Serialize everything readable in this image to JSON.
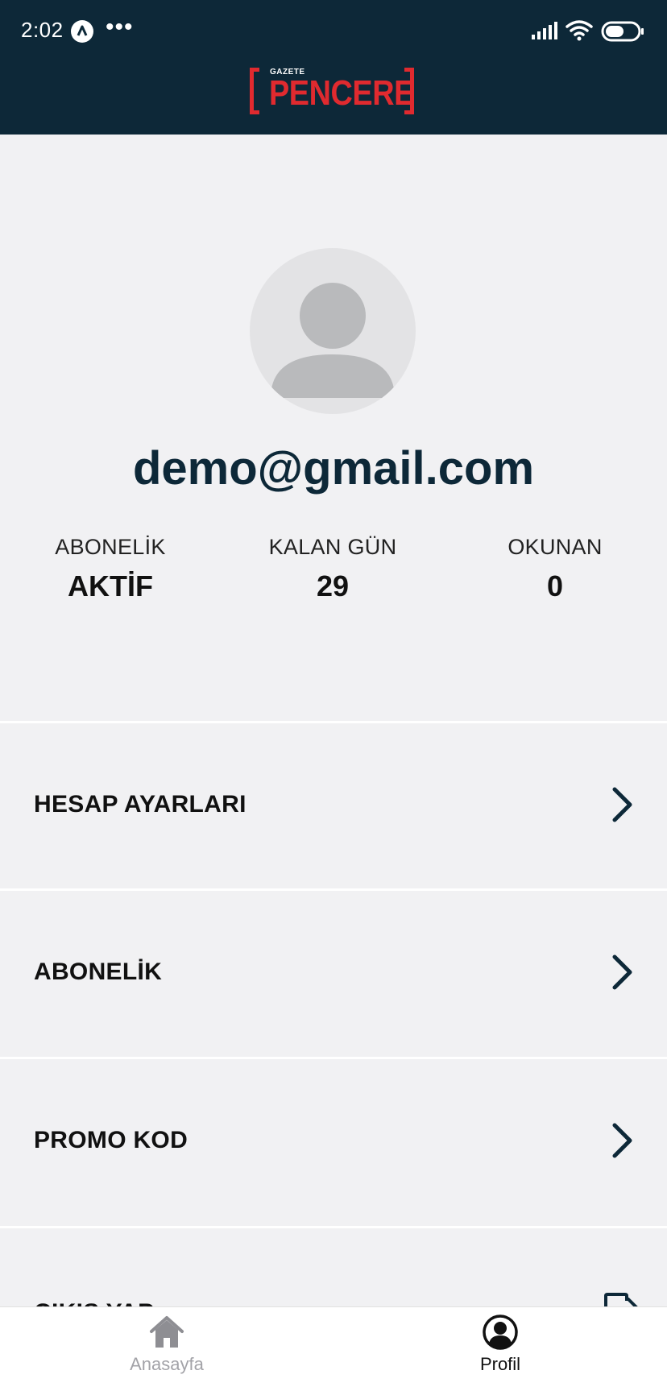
{
  "status_bar": {
    "time": "2:02",
    "dots": "•••"
  },
  "header": {
    "logo_small": "GAZETE",
    "logo_main": "PENCERE",
    "logo_color": "#e02a2f",
    "background": "#0d2838"
  },
  "profile": {
    "email": "demo@gmail.com",
    "stats": [
      {
        "label": "ABONELİK",
        "value": "AKTİF"
      },
      {
        "label": "KALAN GÜN",
        "value": "29"
      },
      {
        "label": "OKUNAN",
        "value": "0"
      }
    ]
  },
  "menu": {
    "items": [
      {
        "label": "HESAP AYARLARI",
        "icon": "chevron-right-icon"
      },
      {
        "label": "ABONELİK",
        "icon": "chevron-right-icon"
      },
      {
        "label": "PROMO KOD",
        "icon": "chevron-right-icon"
      },
      {
        "label": "ÇIKIŞ YAP",
        "icon": "logout-icon"
      }
    ]
  },
  "bottom_nav": {
    "items": [
      {
        "label": "Anasayfa",
        "icon": "home-icon",
        "active": false
      },
      {
        "label": "Profil",
        "icon": "profile-icon",
        "active": true
      }
    ]
  }
}
